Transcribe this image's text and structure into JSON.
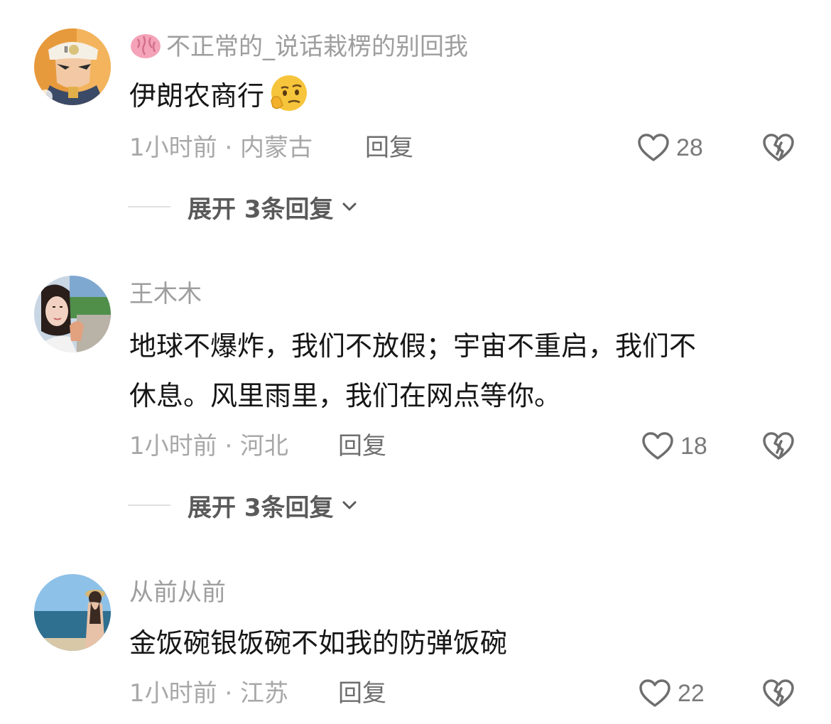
{
  "comments": [
    {
      "username": "不正常的_说话栽楞的别回我",
      "text": "伊朗农商行",
      "emoji": "thinking-face-emoji",
      "time_location": "1小时前 · 内蒙古",
      "reply_label": "回复",
      "likes": "28",
      "expand_label": "展开 3条回复",
      "avatar": "anime-character-avatar",
      "username_prefix_icon": "brain-emoji"
    },
    {
      "username": "王木木",
      "text_line1": "地球不爆炸，我们不放假；宇宙不重启，我们不",
      "text_line2": "休息。风里雨里，我们在网点等你。",
      "time_location": "1小时前 · 河北",
      "reply_label": "回复",
      "likes": "18",
      "expand_label": "展开 3条回复",
      "avatar": "woman-selfie-avatar"
    },
    {
      "username": "从前从前",
      "text": "金饭碗银饭碗不如我的防弹饭碗",
      "time_location": "1小时前 · 江苏",
      "reply_label": "回复",
      "likes": "22",
      "avatar": "beach-avatar"
    }
  ],
  "icons": {
    "like": "heart-outline-icon",
    "dislike": "broken-heart-icon",
    "expand": "chevron-down-icon"
  },
  "colors": {
    "username": "#9e9e9e",
    "text": "#161616",
    "meta": "#a8a8a8",
    "reply": "#6e6e6e",
    "icon": "#6e6e6e"
  }
}
